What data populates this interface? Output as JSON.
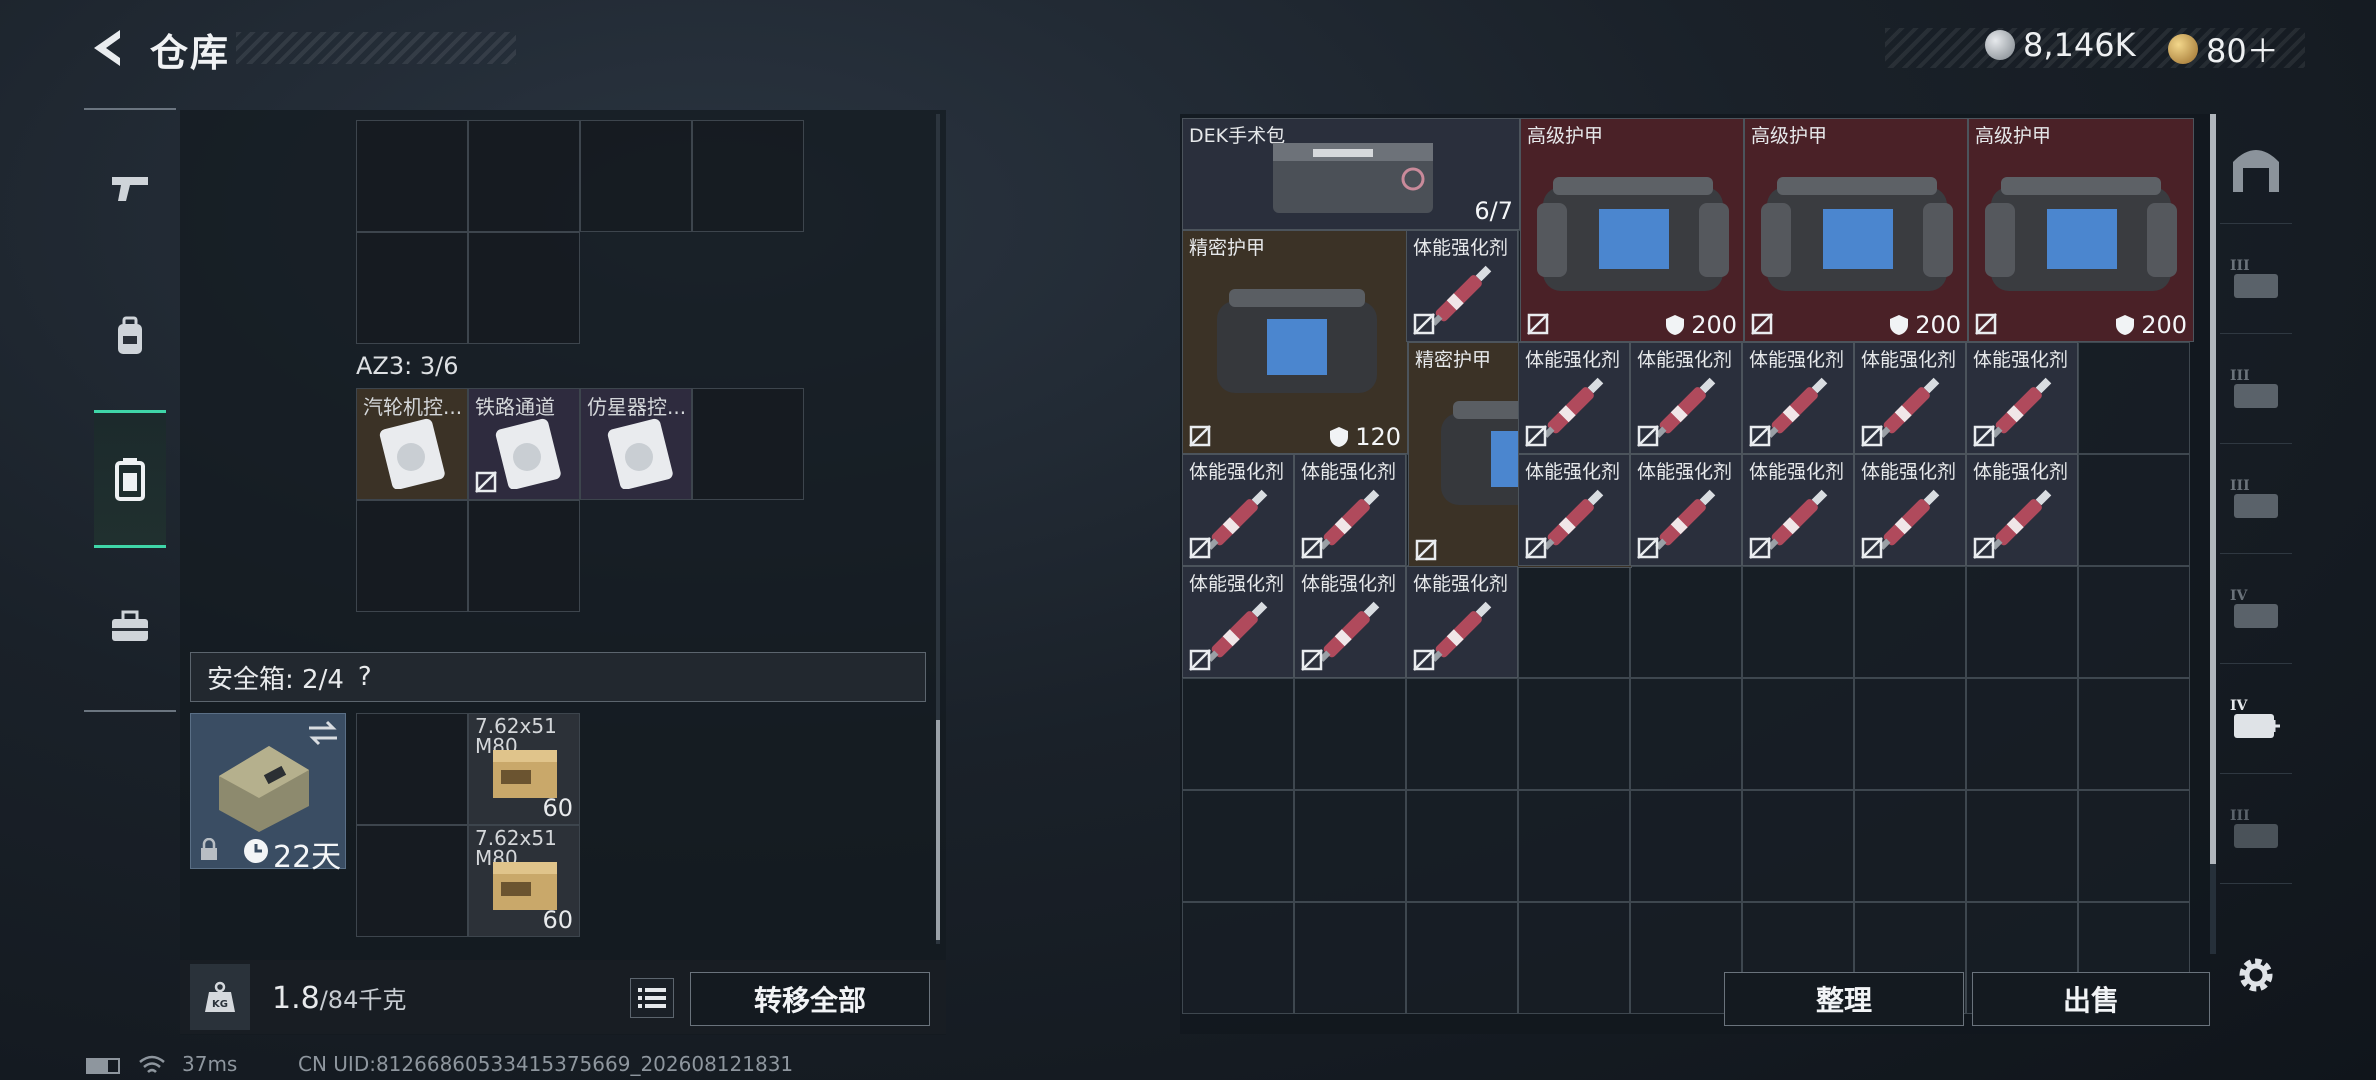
{
  "header": {
    "title": "仓库"
  },
  "currency": {
    "silver": "8,146K",
    "gold": "80＋"
  },
  "nav": {
    "items": [
      "weapon",
      "backpack",
      "storage",
      "toolbox"
    ]
  },
  "left_grid": {
    "az3_label": "AZ3: 3/6",
    "slots": [
      {
        "label": "汽轮机控..."
      },
      {
        "label": "铁路通道"
      },
      {
        "label": "仿星器控..."
      }
    ]
  },
  "safe": {
    "label": "安全箱: 2/4",
    "help": "?",
    "days": "22天",
    "ammo": [
      {
        "name": "7.62x51 M80",
        "count": "60"
      },
      {
        "name": "7.62x51 M80",
        "count": "60"
      }
    ]
  },
  "weight": {
    "current": "1.8",
    "max": "/84千克"
  },
  "buttons": {
    "transfer_all": "转移全部",
    "sort": "整理",
    "sell": "出售"
  },
  "items": {
    "dek": {
      "name": "DEK手术包",
      "count": "6/7"
    },
    "armor_high": {
      "name": "高级护甲",
      "durability": "200"
    },
    "armor_precise": {
      "name": "精密护甲",
      "durability": "120"
    },
    "stim": {
      "name": "体能强化剂"
    }
  },
  "status_bar": {
    "ping": "37ms",
    "uid": "CN UID:81266860533415375669_202608121831"
  },
  "colors": {
    "accent": "#3fd6a8",
    "red_rarity": "#4a2127",
    "gold_rarity": "#3b3226",
    "purple_rarity": "#2e2b3e"
  }
}
